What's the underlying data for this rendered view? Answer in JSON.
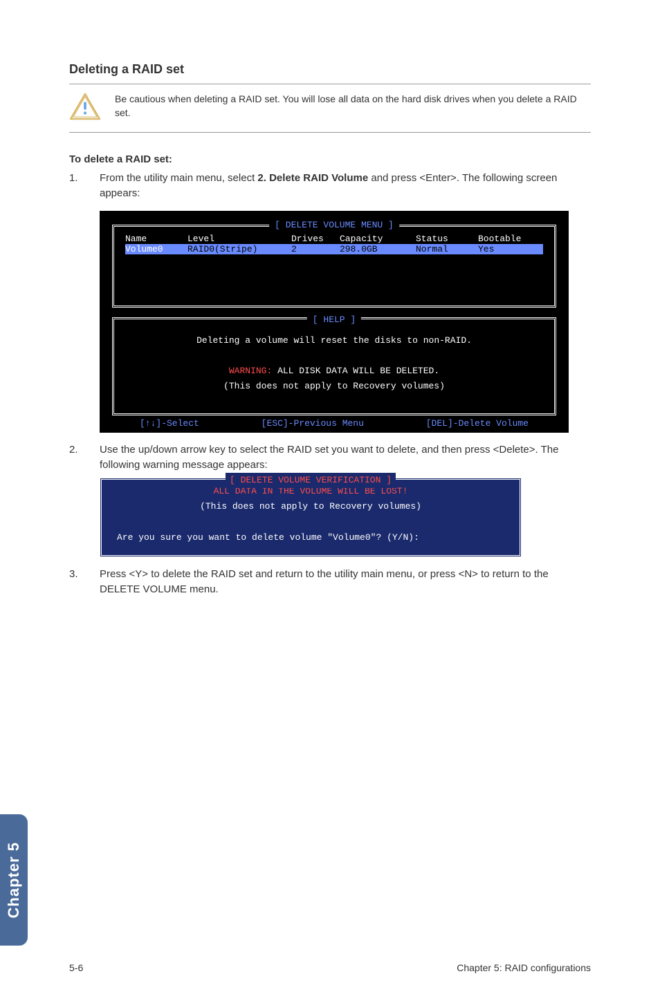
{
  "section": {
    "title": "Deleting a RAID set",
    "caution": "Be cautious when deleting a RAID set. You will lose all data on the hard disk drives when you delete a RAID set.",
    "sub_title": "To delete a RAID set:",
    "step1_num": "1.",
    "step1_a": "From the utility main menu, select ",
    "step1_b": "2. Delete RAID Volume",
    "step1_c": " and press <Enter>. The following screen appears:",
    "step2_num": "2.",
    "step2_text": "Use the up/down arrow key to select the RAID set you want to delete, and then press <Delete>. The following warning message appears:",
    "step3_num": "3.",
    "step3_text": "Press <Y> to delete the RAID set and return to the utility main menu, or press <N> to return to the DELETE VOLUME menu."
  },
  "bios": {
    "menu_title": "[ DELETE VOLUME MENU ]",
    "headers": {
      "name": "Name",
      "level": "Level",
      "drives": "Drives",
      "capacity": "Capacity",
      "status": "Status",
      "bootable": "Bootable"
    },
    "row": {
      "name": "Volume0",
      "level": "RAID0(Stripe)",
      "drives": "2",
      "capacity": "298.0GB",
      "status": "Normal",
      "bootable": "Yes"
    },
    "help_title": "[ HELP ]",
    "help_line1": "Deleting a volume will reset the disks to non-RAID.",
    "help_warn_label": "WARNING:",
    "help_warn_text": " ALL DISK DATA WILL BE DELETED.",
    "help_line3": "(This does not apply to Recovery volumes)",
    "footer_select": "[↑↓]-Select",
    "footer_prev": "[ESC]-Previous Menu",
    "footer_del": "[DEL]-Delete Volume"
  },
  "verify": {
    "title": "[ DELETE VOLUME VERIFICATION ]",
    "line1": "ALL DATA IN THE VOLUME WILL BE LOST!",
    "line2": "(This does not apply to Recovery volumes)",
    "line3": "Are you sure you want to delete volume \"Volume0\"? (Y/N):"
  },
  "tab": "Chapter 5",
  "footer": {
    "left": "5-6",
    "right": "Chapter 5: RAID configurations"
  }
}
